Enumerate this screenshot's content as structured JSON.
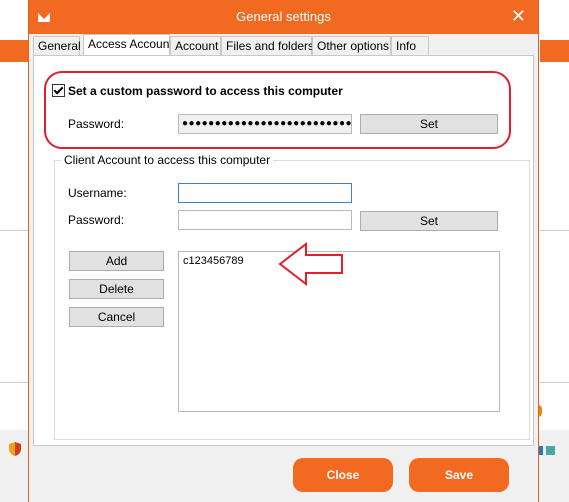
{
  "window": {
    "title": "General settings"
  },
  "tabs": [
    {
      "label": "General"
    },
    {
      "label": "Access Account"
    },
    {
      "label": "Account"
    },
    {
      "label": "Files and folders"
    },
    {
      "label": "Other options"
    },
    {
      "label": "Info"
    }
  ],
  "custom_password": {
    "checkbox_label": "Set a custom password to access this computer",
    "checked": true,
    "password_label": "Password:",
    "password_value": "●●●●●●●●●●●●●●●●●●●●●●●●●●●●●",
    "set_label": "Set"
  },
  "client_account": {
    "group_title": "Client Account to access this computer",
    "username_label": "Username:",
    "username_value": "",
    "password_label": "Password:",
    "password_value": "",
    "set_label": "Set",
    "add_label": "Add",
    "delete_label": "Delete",
    "cancel_label": "Cancel",
    "accounts": [
      "c123456789"
    ]
  },
  "footer": {
    "close_label": "Close",
    "save_label": "Save"
  },
  "colors": {
    "accent": "#f26a21",
    "highlight": "#e02030"
  }
}
